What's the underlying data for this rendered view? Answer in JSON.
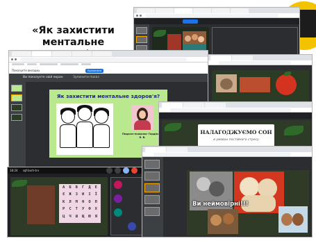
{
  "heading": {
    "line1": "«Як захистити",
    "line2": "ментальне здоров'я»"
  },
  "main_window": {
    "banner_text": "Ви показуєте свій екран",
    "stop_button": "Зупинити показ",
    "bookmark_labels": [
      "YouTube",
      "Карти",
      "Діловоди пишуть",
      "Спільна робота",
      "Чат"
    ],
    "share_notice": "Показуєте вкладку",
    "share_stop": "Припинити",
    "slide_title": "Як захистити ментальне здоров'я?",
    "portrait_caption": "Педагог-психолог Гордієнко Я. В.",
    "time_label": "18:24",
    "meet_code": "sqf-bxrh-trv"
  },
  "sleep_window": {
    "title": "НАЛАГОДЖУЄМО СОН",
    "subtitle": "в умовах постійного стресу"
  },
  "wow_window": {
    "caption": "Ви неймовірні!!!"
  },
  "colors": {
    "slide_green": "#b9e88e",
    "title_blue": "#1a2a7a",
    "accent_yellow": "#f4c300",
    "meet_dark": "#202124"
  },
  "icons": [
    "mic-icon",
    "camera-icon",
    "present-icon",
    "hangup-icon",
    "people-icon",
    "chat-icon"
  ],
  "letters": [
    "А",
    "Б",
    "В",
    "Г",
    "Д",
    "Е",
    "Є",
    "Ж",
    "З",
    "И",
    "І",
    "Ї",
    "К",
    "Л",
    "М",
    "Н",
    "О",
    "П",
    "Р",
    "С",
    "Т",
    "У",
    "Ф",
    "Х",
    "Ц",
    "Ч",
    "Ш",
    "Щ",
    "Ю",
    "Я"
  ]
}
